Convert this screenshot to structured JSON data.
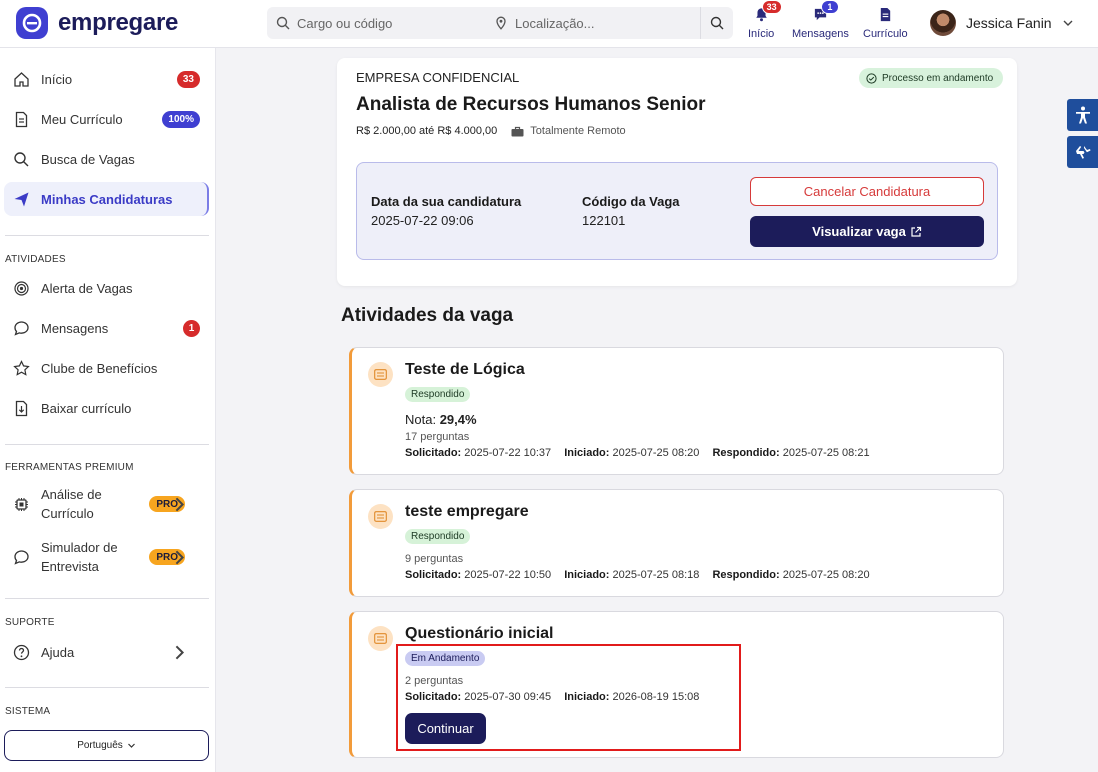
{
  "brand": {
    "name": "empregare",
    "accent": "#3f3fd1",
    "navy": "#1c1c5a"
  },
  "search": {
    "role_placeholder": "Cargo ou código",
    "location_placeholder": "Localização..."
  },
  "topnav": {
    "home": {
      "label": "Início",
      "badge": "33"
    },
    "messages": {
      "label": "Mensagens",
      "badge": "1"
    },
    "resume": {
      "label": "Currículo"
    },
    "user_name": "Jessica Fanin"
  },
  "sidebar": {
    "items": [
      {
        "label": "Início",
        "icon": "home-icon",
        "badge": "33"
      },
      {
        "label": "Meu Currículo",
        "icon": "document-icon",
        "badge": "100%"
      },
      {
        "label": "Busca de Vagas",
        "icon": "search-icon"
      },
      {
        "label": "Minhas Candidaturas",
        "icon": "send-icon"
      }
    ],
    "activities_section": "ATIVIDADES",
    "activities": [
      {
        "label": "Alerta de Vagas",
        "icon": "target-icon"
      },
      {
        "label": "Mensagens",
        "icon": "chat-icon",
        "badge": "1"
      },
      {
        "label": "Clube de Benefícios",
        "icon": "star-icon"
      },
      {
        "label": "Baixar currículo",
        "icon": "download-icon"
      }
    ],
    "premium_section": "FERRAMENTAS PREMIUM",
    "premium": [
      {
        "label": "Análise de Currículo",
        "icon": "chip-icon",
        "badge": "PRO"
      },
      {
        "label": "Simulador de Entrevista",
        "icon": "chat-icon",
        "badge": "PRO"
      }
    ],
    "support_section": "SUPORTE",
    "support": [
      {
        "label": "Ajuda",
        "icon": "help-icon"
      }
    ],
    "system_section": "SISTEMA",
    "language": "Português"
  },
  "job": {
    "company": "EMPRESA CONFIDENCIAL",
    "status": "Processo em andamento",
    "title": "Analista de Recursos Humanos Senior",
    "salary": "R$ 2.000,00 até R$ 4.000,00",
    "mode": "Totalmente Remoto",
    "applied_label": "Data da sua candidatura",
    "applied_value": "2025-07-22 09:06",
    "code_label": "Código da Vaga",
    "code_value": "122101",
    "cancel_label": "Cancelar Candidatura",
    "view_label": "Visualizar vaga"
  },
  "activities_title": "Atividades da vaga",
  "activities": [
    {
      "title": "Teste de Lógica",
      "status": "Respondido",
      "score_label": "Nota:",
      "score_value": "29,4%",
      "questions": "17 perguntas",
      "requested_label": "Solicitado:",
      "requested": "2025-07-22 10:37",
      "started_label": "Iniciado:",
      "started": "2025-07-25 08:20",
      "answered_label": "Respondido:",
      "answered": "2025-07-25 08:21"
    },
    {
      "title": "teste empregare",
      "status": "Respondido",
      "questions": "9 perguntas",
      "requested_label": "Solicitado:",
      "requested": "2025-07-22 10:50",
      "started_label": "Iniciado:",
      "started": "2025-07-25 08:18",
      "answered_label": "Respondido:",
      "answered": "2025-07-25 08:20"
    },
    {
      "title": "Questionário inicial",
      "status": "Em Andamento",
      "questions": "2 perguntas",
      "requested_label": "Solicitado:",
      "requested": "2025-07-30 09:45",
      "started_label": "Iniciado:",
      "started": "2026-08-19 15:08",
      "continue_label": "Continuar"
    }
  ]
}
